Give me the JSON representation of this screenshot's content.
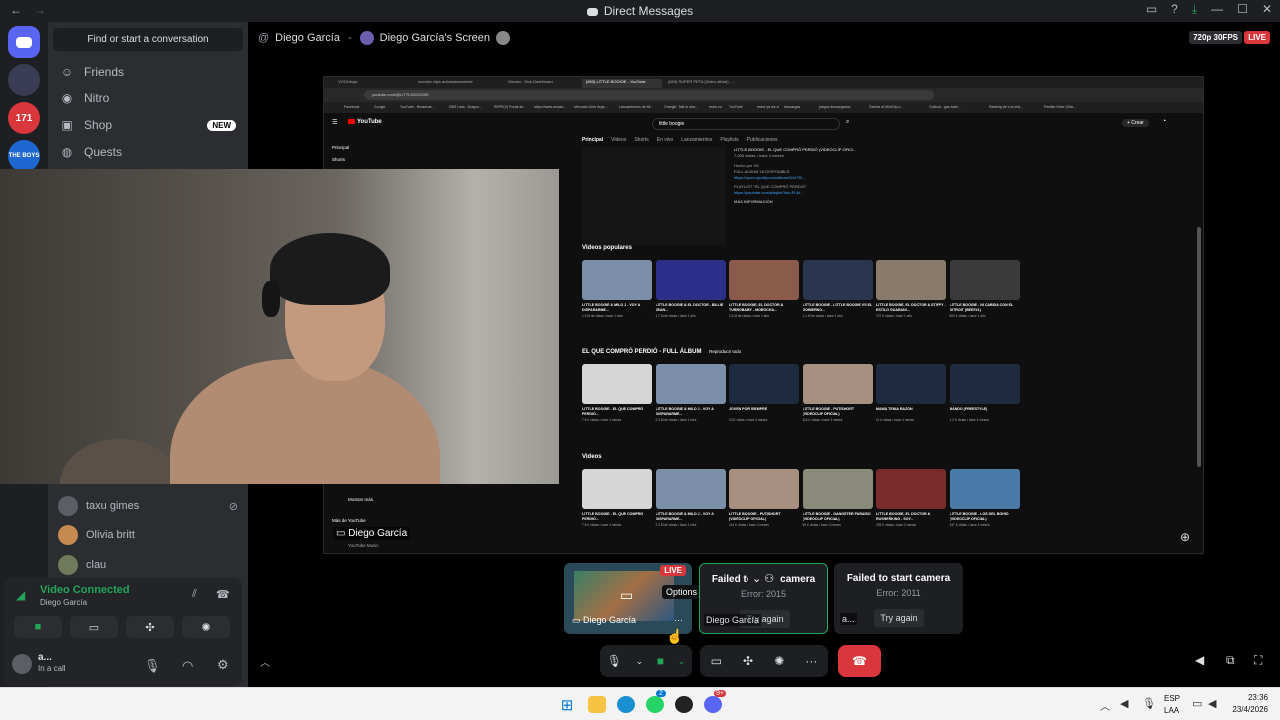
{
  "window": {
    "title": "Direct Messages"
  },
  "sidebar": {
    "search_placeholder": "Find or start a conversation",
    "nav": [
      {
        "label": "Friends",
        "icon": "friends-icon"
      },
      {
        "label": "Nitro",
        "icon": "nitro-icon"
      },
      {
        "label": "Shop",
        "icon": "shop-icon",
        "badge": "NEW"
      },
      {
        "label": "Quests",
        "icon": "quests-icon"
      }
    ],
    "servers": [
      {
        "label": "",
        "color": "#5865f2"
      },
      {
        "label": "",
        "color": "#3ba55c"
      },
      {
        "label": "171",
        "color": "#da373c"
      },
      {
        "label": "THE BOYS",
        "color": "#1e66d0"
      }
    ],
    "dms": [
      {
        "name": "taxu gimes",
        "color": "#5c5e66"
      },
      {
        "name": "Olivia britt",
        "color": "#c58a4f"
      },
      {
        "name": "clau",
        "color": "#6f7a5a"
      }
    ]
  },
  "voice_panel": {
    "status": "Video Connected",
    "user": "Diego García",
    "account_name": "a...",
    "account_status": "In a call"
  },
  "stage": {
    "user": "Diego García",
    "screen_title": "Diego García's Screen",
    "quality": "720p 30FPS",
    "live": "LIVE",
    "cam_name": "Diego García"
  },
  "browser": {
    "tabs": [
      "VOGUboja",
      "recortar clips automaticamente",
      "Stream - Kick Dashboard",
      "(653) LITTLE BOOGIE - YouTube",
      "(653) SUPER PETA (Video oficial) - ..."
    ],
    "url": "youtube.com/@LITTLEBOOGIE",
    "bookmarks": [
      "Facebook",
      "Google",
      "YouTube - Broadcas...",
      "DBS Lista - Dragon...",
      "REPE(X) Portal de...",
      "https://www.amazo...",
      "Mercado Libre Arge...",
      "Lanzamientos de Mi...",
      "Omegle: Talk to stra...",
      "estoc no",
      "YouTube",
      "estos ya los vi",
      "descargas",
      "juegos descargados",
      "Games at MiniClip.c...",
      "Outlook - gan.tade...",
      "Ranking de Los mej...",
      "Pesitito Kfver (Vivk..."
    ],
    "search": "little boogie",
    "create": "+ Crear",
    "side_items": [
      "Principal",
      "Shorts"
    ],
    "side_bottom": [
      "Mostrar más",
      "Más de YouTube",
      "YouTube Music"
    ],
    "channel_tabs": [
      "Principal",
      "Videos",
      "Shorts",
      "En vivo",
      "Lanzamientos",
      "Playlists",
      "Publicaciones"
    ],
    "description": [
      "LITTLE BOOGIE - EL QUE COMPRÓ PERDIÓ (VIDEOCLIP OFICI...",
      "7,006 vistas • hace 4 meses",
      "Hecho por Gli",
      "FULL ALBUM YA DISPONIBLE:",
      "https://open.spotify.com/album/3oU7f0...",
      "PLAYLIST \"EL QUE COMPRÓ PERDIÓ\"",
      "https://youtube.com/playlist?list=PLM...",
      "MÁS INFORMACIÓN"
    ],
    "sections": [
      {
        "title": "Videos populares",
        "videos": [
          {
            "title": "LITTLE BOOGIE & MILO J - VOY A DISPARARME...",
            "meta": "1.3 M de vistas • hace 1 mes",
            "color": "#7b8fa8"
          },
          {
            "title": "LITTLE BOOGIE & EL DOCTOR - BILLIE JEAN...",
            "meta": "1.7 M de vistas • hace 1 año",
            "color": "#2b2f8a"
          },
          {
            "title": "LITTLE BOOGIE, EL DOCTOR & TURROBABY - MOROCHA...",
            "meta": "1.5 M de vistas • hace 1 año",
            "color": "#8a5a4a"
          },
          {
            "title": "LITTLE BOOGIE - LITTLE BOOGIE VS EL GOBIERNO...",
            "meta": "1.1 M de vistas • hace 1 año",
            "color": "#2a3550"
          },
          {
            "title": "LITTLE BOOGIE, EL DOCTOR & STIFFY - ESTILO GUARANI...",
            "meta": "727 K vistas • hace 1 año",
            "color": "#8a7a6a"
          },
          {
            "title": "LITTLE BOOGIE - NI CABIDA CON EL DITROIT (BEEF#1)",
            "meta": "603 K vistas • hace 1 año",
            "color": "#3a3a3a"
          }
        ]
      },
      {
        "title": "EL QUE COMPRÓ PERDIÓ - FULL ÁLBUM",
        "play_all": "Reproducir todo",
        "videos": [
          {
            "title": "LITTLE BOOGIE - EL QUE COMPRÓ PERDIÓ...",
            "meta": "7.5 K vistas • hace 4 meses",
            "color": "#d6d6d6"
          },
          {
            "title": "LITTLE BOOGIE & MILO J - VOY A DISPARARME...",
            "meta": "2.3 M de vistas • hace 1 mes",
            "color": "#7b8fa8"
          },
          {
            "title": "JOVEN POR SIEMPRE",
            "meta": "13 K vistas • hace 4 meses",
            "color": "#1d2a40"
          },
          {
            "title": "LITTLE BOOGIE - PUTISHORT (VIDEOCLIP OFICIAL)",
            "meta": "114 K vistas • hace 3 meses",
            "color": "#a89080"
          },
          {
            "title": "MAMÁ TENIA RAZÓN",
            "meta": "11 K vistas • hace 4 meses",
            "color": "#1d2a40"
          },
          {
            "title": "BANDO (FREESTYLE)",
            "meta": "1.2 K vistas • hace 4 meses",
            "color": "#1d2a40"
          }
        ]
      },
      {
        "title": "Videos",
        "videos": [
          {
            "title": "LITTLE BOOGIE - EL QUE COMPRÓ PERDIÓ...",
            "meta": "7.5 K vistas • hace 4 meses",
            "color": "#d6d6d6"
          },
          {
            "title": "LITTLE BOOGIE & MILO J - VOY A DISPARARME...",
            "meta": "2.3 M de vistas • hace 1 mes",
            "color": "#7b8fa8"
          },
          {
            "title": "LITTLE BOOGIE - PUTISHORT (VIDEOCLIP OFICIAL)",
            "meta": "114 K vistas • hace 3 meses",
            "color": "#a89080"
          },
          {
            "title": "LITTLE BOOGIE - GANGSTER PARAÍSO (VIDEOCLIP OFICIAL)",
            "meta": "50 K vistas • hace 3 meses",
            "color": "#8a8a7a"
          },
          {
            "title": "LITTLE BOOGIE, EL DOCTOR & RUSHERKING - SOY...",
            "meta": "229 K vistas • hace 3 meses",
            "color": "#7a2a2a"
          },
          {
            "title": "LITTLE BOOGIE - LOS DEL BOHÍO (VIDEOCLIP OFICIAL)",
            "meta": "247 K vistas • hace 3 meses",
            "color": "#4a7aa8"
          }
        ]
      }
    ]
  },
  "tiles": {
    "stream_tile": {
      "live": "LIVE",
      "options": "Options",
      "name": "Diego García"
    },
    "cam_tile_1": {
      "title": "Failed to start camera",
      "error": "Error: 2015",
      "retry": "Try again",
      "name": "Diego García"
    },
    "cam_tile_2": {
      "title": "Failed to start camera",
      "error": "Error: 2011",
      "retry": "Try again",
      "name": "a..."
    }
  },
  "taskbar": {
    "lang": "ESP",
    "lang_sub": "LAA",
    "time": "23:36",
    "date": "23/4/2026",
    "badge_whatsapp": "2",
    "badge_discord": "9+"
  },
  "colors": {
    "green": "#23a55a",
    "red": "#da373c",
    "blurple": "#5865f2"
  }
}
